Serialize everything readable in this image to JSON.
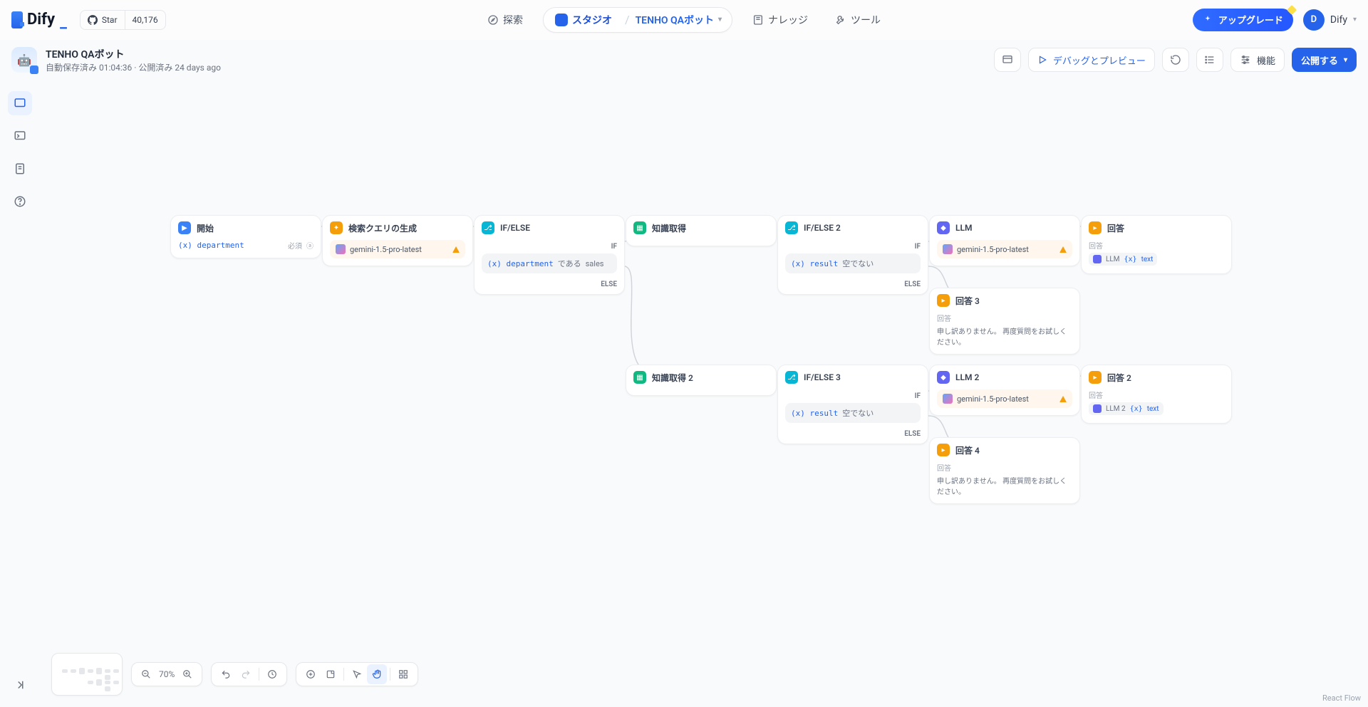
{
  "brand": {
    "name": "Dify",
    "avatar_letter": "D",
    "workspace": "Dify"
  },
  "github": {
    "star_label": "Star",
    "count": "40,176"
  },
  "nav": {
    "explore": "探索",
    "studio": "スタジオ",
    "project": "TENHO QAボット",
    "knowledge": "ナレッジ",
    "tools": "ツール",
    "upgrade": "アップグレード"
  },
  "sub": {
    "title": "TENHO QAボット",
    "autosave": "自動保存済み 01:04:36",
    "published": "公開済み 24 days ago",
    "debug": "デバッグとプレビュー",
    "features": "機能",
    "publish": "公開する"
  },
  "zoom": "70%",
  "attribution": "React Flow",
  "labels": {
    "if": "IF",
    "else": "ELSE",
    "dearu": "である",
    "kara_denai": "空でない",
    "required": "必須",
    "text_chip": "text",
    "answer_header": "回答"
  },
  "nodes": {
    "start": {
      "title": "開始",
      "var": "department"
    },
    "gen": {
      "title": "検索クエリの生成",
      "model": "gemini-1.5-pro-latest"
    },
    "if1": {
      "title": "IF/ELSE",
      "var": "department",
      "value": "sales"
    },
    "kn1": {
      "title": "知識取得"
    },
    "kn2": {
      "title": "知識取得 2"
    },
    "if2": {
      "title": "IF/ELSE 2",
      "var": "result"
    },
    "if3": {
      "title": "IF/ELSE 3",
      "var": "result"
    },
    "llm1": {
      "title": "LLM",
      "model": "gemini-1.5-pro-latest"
    },
    "llm2": {
      "title": "LLM 2",
      "model": "gemini-1.5-pro-latest"
    },
    "ans1": {
      "title": "回答",
      "src": "LLM"
    },
    "ans2": {
      "title": "回答 2",
      "src": "LLM 2"
    },
    "ans3": {
      "title": "回答 3",
      "text": "申し訳ありません。 再度質問をお試しください。"
    },
    "ans4": {
      "title": "回答 4",
      "text": "申し訳ありません。 再度質問をお試しください。"
    }
  }
}
